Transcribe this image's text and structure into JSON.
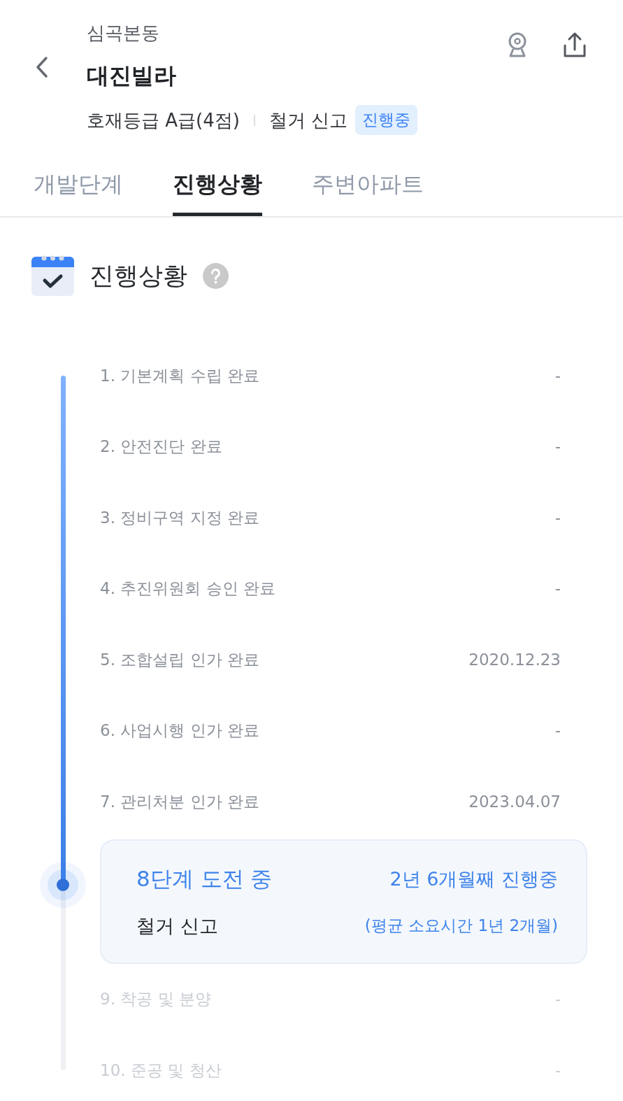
{
  "header": {
    "subtitle": "심곡본동",
    "title": "대진빌라",
    "grade": "호재등급 A급(4점)",
    "stage": "철거 신고",
    "status_badge": "진행중"
  },
  "tabs": [
    {
      "label": "개발단계",
      "selected": false
    },
    {
      "label": "진행상황",
      "selected": true
    },
    {
      "label": "주변아파트",
      "selected": false
    }
  ],
  "section": {
    "title": "진행상황"
  },
  "timeline": {
    "level": 0.733,
    "steps": [
      {
        "kind": "done",
        "label": "1. 기본계획 수립 완료",
        "date": "-"
      },
      {
        "kind": "done",
        "label": "2. 안전진단 완료",
        "date": "-"
      },
      {
        "kind": "done",
        "label": "3. 정비구역 지정 완료",
        "date": "-"
      },
      {
        "kind": "done",
        "label": "4. 추진위원회 승인 완료",
        "date": "-"
      },
      {
        "kind": "done",
        "label": "5. 조합설립 인가 완료",
        "date": "2020.12.23"
      },
      {
        "kind": "done",
        "label": "6. 사업시행 인가 완료",
        "date": "-"
      },
      {
        "kind": "done",
        "label": "7. 관리처분 인가 완료",
        "date": "2023.04.07"
      },
      {
        "kind": "current",
        "heading": "8단계 도전 중",
        "elapsed": "2년 6개월째 진행중",
        "label": "철거 신고",
        "average": "(평균 소요시간 1년 2개월)"
      },
      {
        "kind": "upcoming",
        "label": "9. 착공 및 분양",
        "date": "-"
      },
      {
        "kind": "upcoming",
        "label": "10. 준공 및 청산",
        "date": "-"
      }
    ]
  }
}
